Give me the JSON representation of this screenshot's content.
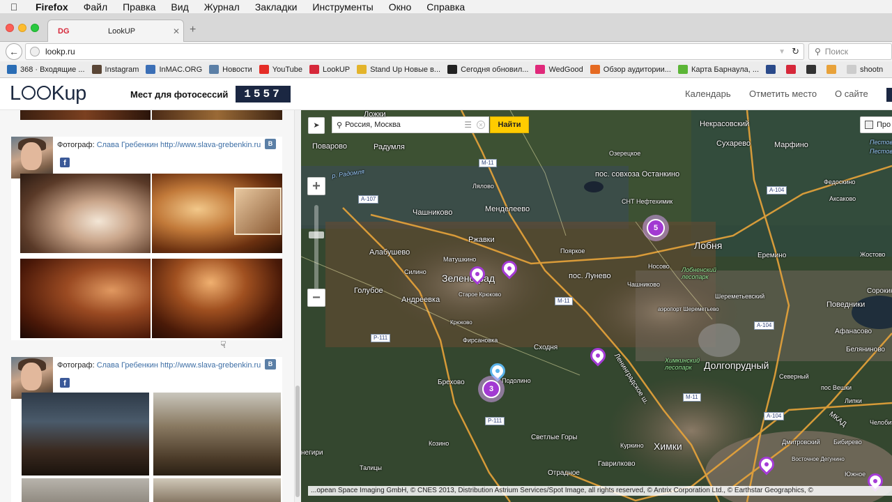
{
  "menubar": {
    "app": "Firefox",
    "items": [
      "Файл",
      "Правка",
      "Вид",
      "Журнал",
      "Закладки",
      "Инструменты",
      "Окно",
      "Справка"
    ]
  },
  "tab": {
    "favicon": "DG",
    "title": "LookUP"
  },
  "url": "lookp.ru",
  "search": {
    "placeholder": "Поиск"
  },
  "bookmarks": [
    {
      "label": "368 · Входящие ...",
      "icon": "mail-icon",
      "color": "#2a6db5"
    },
    {
      "label": "Instagram",
      "icon": "instagram-icon",
      "color": "#5a4636"
    },
    {
      "label": "InMAC.ORG",
      "icon": "inmac-icon",
      "color": "#3b6fb6"
    },
    {
      "label": "Новости",
      "icon": "vk-icon",
      "color": "#5b7fa6"
    },
    {
      "label": "YouTube",
      "icon": "youtube-icon",
      "color": "#e52d27"
    },
    {
      "label": "LookUP",
      "icon": "lookup-icon",
      "color": "#d6283a"
    },
    {
      "label": "Stand Up Новые в...",
      "icon": "standup-icon",
      "color": "#e3b42b"
    },
    {
      "label": "Сегодня обновил...",
      "icon": "github-icon",
      "color": "#222222"
    },
    {
      "label": "WedGood",
      "icon": "wedgood-icon",
      "color": "#e0297a"
    },
    {
      "label": "Обзор аудитории...",
      "icon": "chart-icon",
      "color": "#e56a22"
    },
    {
      "label": "Карта Барнаула, ...",
      "icon": "2gis-icon",
      "color": "#5bb536"
    },
    {
      "label": "",
      "icon": "bm-icon",
      "color": "#2a4a8a"
    },
    {
      "label": "",
      "icon": "dg-icon",
      "color": "#d6283a"
    },
    {
      "label": "",
      "icon": "terminal-icon",
      "color": "#333333"
    },
    {
      "label": "",
      "icon": "stack-icon",
      "color": "#e8a23a"
    },
    {
      "label": "shootn",
      "icon": "page-icon",
      "color": "#cccccc"
    }
  ],
  "header": {
    "logo": {
      "a": "L",
      "b": "Kup"
    },
    "counter_label": "Мест для фотосессий",
    "counter": "1557",
    "nav": [
      "Календарь",
      "Отметить место",
      "О сайте"
    ]
  },
  "cards": [
    {
      "label": "Фотограф:",
      "name": "Слава Гребенкин",
      "url": "http://www.slava-grebenkin.ru",
      "vk": "В",
      "fb": "f"
    },
    {
      "label": "Фотограф:",
      "name": "Слава Гребенкин",
      "url": "http://www.slava-grebenkin.ru",
      "vk": "В",
      "fb": "f"
    }
  ],
  "map": {
    "search_value": "Россия, Москва",
    "find_label": "Найти",
    "layer_label": "Про",
    "zoom_in": "+",
    "zoom_out": "−",
    "clusters": [
      "5",
      "3"
    ],
    "copyright": "...opean Space Imaging GmbH, © CNES 2013, Distribution Astrium Services/Spot Image, all rights reserved, © Antrix Corporation Ltd., © Earthstar Geographics, ©",
    "labels": [
      "Некрасовский",
      "Сухарево",
      "Марфино",
      "Пестово",
      "Поварово",
      "Радумля",
      "Ложки",
      "Озерецкое",
      "пос. совхоза Останкино",
      "Федоскино",
      "Лялово",
      "Чашниково",
      "Менделеево",
      "СНТ Нефтехимик",
      "Акcаково",
      "Ржавки",
      "Алабушево",
      "Пояркое",
      "пос. Лунево",
      "Носово",
      "Еремино",
      "Жостово",
      "Матушкино",
      "Силино",
      "Голубое",
      "Андреевка",
      "Старое Крюково",
      "Чашниково",
      "Шереметьевский",
      "Сорокино",
      "Поведники",
      "аэропорт Шереметьево",
      "Фирсановка",
      "Сходня",
      "Афанасово",
      "Беляниново",
      "Брехово",
      "Подолино",
      "Северный",
      "пос Вешки",
      "Липки",
      "Козино",
      "Светлые Горы",
      "Куркино",
      "Гаврилково",
      "Отрадное",
      "Дмитровский",
      "Бибирево",
      "Восточное Дегунино",
      "Челобит",
      "Южное",
      "Крюково",
      "Талицы",
      "негири"
    ],
    "big_labels": [
      "Зеленоград",
      "Лобня",
      "Долгопрудный",
      "Химки"
    ],
    "park_labels": [
      "Лобненский лесопарк",
      "Химкинский лесопарк"
    ],
    "water_labels": [
      "р. Радомля",
      "Пестовское"
    ],
    "highways": [
      "М-11",
      "А-107",
      "М-11",
      "А-104",
      "А-104",
      "Р-111",
      "М-11",
      "Р-111",
      "А-104",
      "МКАД"
    ],
    "road_label": "Ленинградское ш."
  }
}
